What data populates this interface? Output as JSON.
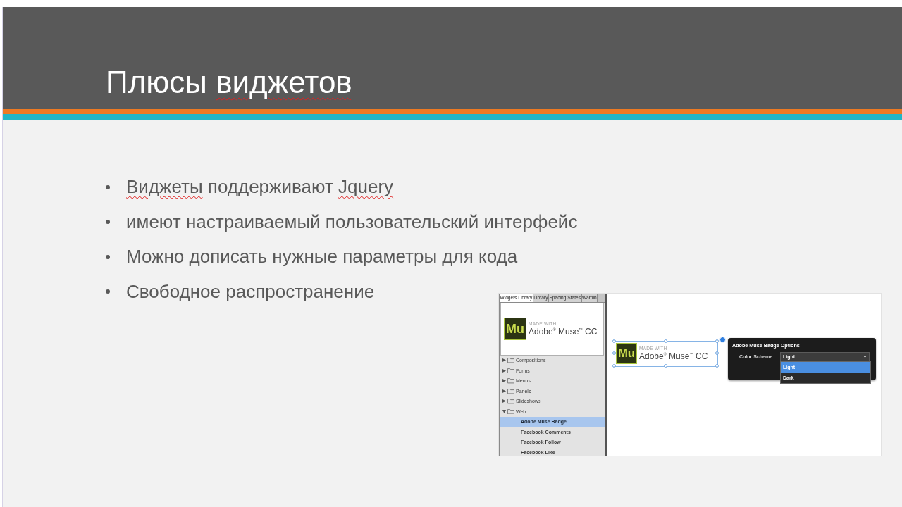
{
  "header": {
    "title": {
      "segments": [
        {
          "text": "Плюсы ",
          "misspelled": false
        },
        {
          "text": "виджетов",
          "misspelled": true
        }
      ]
    }
  },
  "bullets": [
    {
      "segments": [
        {
          "text": "Виджеты",
          "misspelled": true
        },
        {
          "text": " поддерживают ",
          "misspelled": false
        },
        {
          "text": "Jquery",
          "misspelled": true
        }
      ]
    },
    {
      "segments": [
        {
          "text": "имеют настраиваемый пользовательский интерфейс",
          "misspelled": false
        }
      ]
    },
    {
      "segments": [
        {
          "text": "Можно дописать нужные параметры для кода",
          "misspelled": false
        }
      ]
    },
    {
      "segments": [
        {
          "text": "Свободное распространение",
          "misspelled": false
        }
      ]
    }
  ],
  "screenshot": {
    "panel": {
      "tabs": [
        {
          "label": "Widgets Library",
          "selected": true
        },
        {
          "label": "Library",
          "selected": false
        },
        {
          "label": "Spacing",
          "selected": false
        },
        {
          "label": "States",
          "selected": false
        },
        {
          "label": "Warnin",
          "selected": false
        }
      ],
      "badge": {
        "logo": "Mu",
        "made_with": "MADE WITH",
        "product": "Adobe$^{®}$ Muse$^{™}$ CC"
      },
      "tree": [
        {
          "label": "Compositions",
          "expanded": false,
          "selected": false
        },
        {
          "label": "Forms",
          "expanded": false,
          "selected": false
        },
        {
          "label": "Menus",
          "expanded": false,
          "selected": false
        },
        {
          "label": "Panels",
          "expanded": false,
          "selected": false
        },
        {
          "label": "Slideshows",
          "expanded": false,
          "selected": false
        },
        {
          "label": "Web",
          "expanded": true,
          "selected": false,
          "children": [
            {
              "label": "Adobe Muse Badge",
              "selected": true
            },
            {
              "label": "Facebook Comments",
              "selected": false
            },
            {
              "label": "Facebook Follow",
              "selected": false
            },
            {
              "label": "Facebook Like",
              "selected": false
            }
          ]
        }
      ]
    },
    "canvas": {
      "badge": {
        "logo": "Mu",
        "made_with": "MADE WITH",
        "product": "Adobe$^{®}$ Muse$^{™}$ CC",
        "selected": true
      },
      "options": {
        "title": "Adobe Muse Badge Options",
        "label": "Color Scheme:",
        "value": "Light",
        "open": true,
        "choices": [
          {
            "label": "Light",
            "selected": true
          },
          {
            "label": "Dark",
            "selected": false
          }
        ]
      }
    }
  }
}
